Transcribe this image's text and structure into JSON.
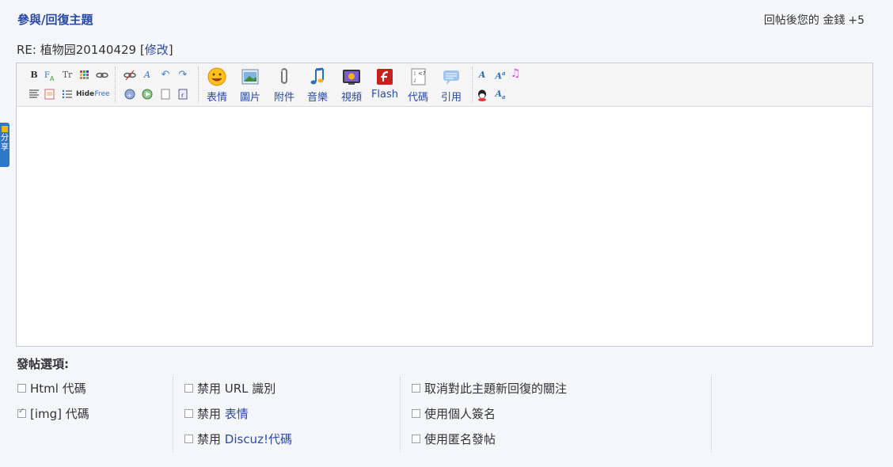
{
  "header": {
    "title_a": "參與",
    "title_sep": "/",
    "title_b": "回復主題",
    "reward_label": "回帖後您的 金錢",
    "reward_amount": "+5"
  },
  "subject": {
    "prefix": "RE: 植物园20140429",
    "bracket_open": "[",
    "edit_link": "修改",
    "bracket_close": "]"
  },
  "toolbar": {
    "small_icons_row1": [
      "B",
      "font-icon",
      "Tr",
      "color-grid-icon",
      "link-icon",
      "unlink-icon",
      "remove-format-icon",
      "undo-icon",
      "redo-icon"
    ],
    "small_icons_row2": [
      "align-icon",
      "image-small-icon",
      "list-icon",
      "Hide",
      "Free",
      "insert-a-icon",
      "insert-b-icon",
      "page-icon",
      "r-icon"
    ],
    "buttons": [
      {
        "label": "表情",
        "icon": "smiley-icon"
      },
      {
        "label": "圖片",
        "icon": "image-icon"
      },
      {
        "label": "附件",
        "icon": "paperclip-icon"
      },
      {
        "label": "音樂",
        "icon": "music-icon"
      },
      {
        "label": "視頻",
        "icon": "video-icon"
      },
      {
        "label": "Flash",
        "icon": "flash-icon"
      },
      {
        "label": "代碼",
        "icon": "code-icon"
      },
      {
        "label": "引用",
        "icon": "quote-icon"
      }
    ],
    "right_icons": [
      "A",
      "A",
      "music-note-icon",
      "qq-icon",
      "A"
    ]
  },
  "share_tab": {
    "line1": "分",
    "line2": "享"
  },
  "options": {
    "title": "發帖選項:",
    "col1": [
      {
        "label_a": "Html",
        "label_b": " 代碼",
        "checked": false
      },
      {
        "label_a": "[img]",
        "label_b": " 代碼",
        "checked": true
      }
    ],
    "col2": [
      {
        "label_a": "禁用 URL 識別",
        "checked": false
      },
      {
        "label_a": "禁用 ",
        "link": "表情",
        "checked": false
      },
      {
        "label_a": "禁用 ",
        "link": "Discuz!代碼",
        "checked": false
      }
    ],
    "col3": [
      {
        "label_a": "取消對此主題新回復的關注",
        "checked": false
      },
      {
        "label_a": "使用個人簽名",
        "checked": false
      },
      {
        "label_a": "使用匿名發帖",
        "checked": false
      }
    ]
  }
}
